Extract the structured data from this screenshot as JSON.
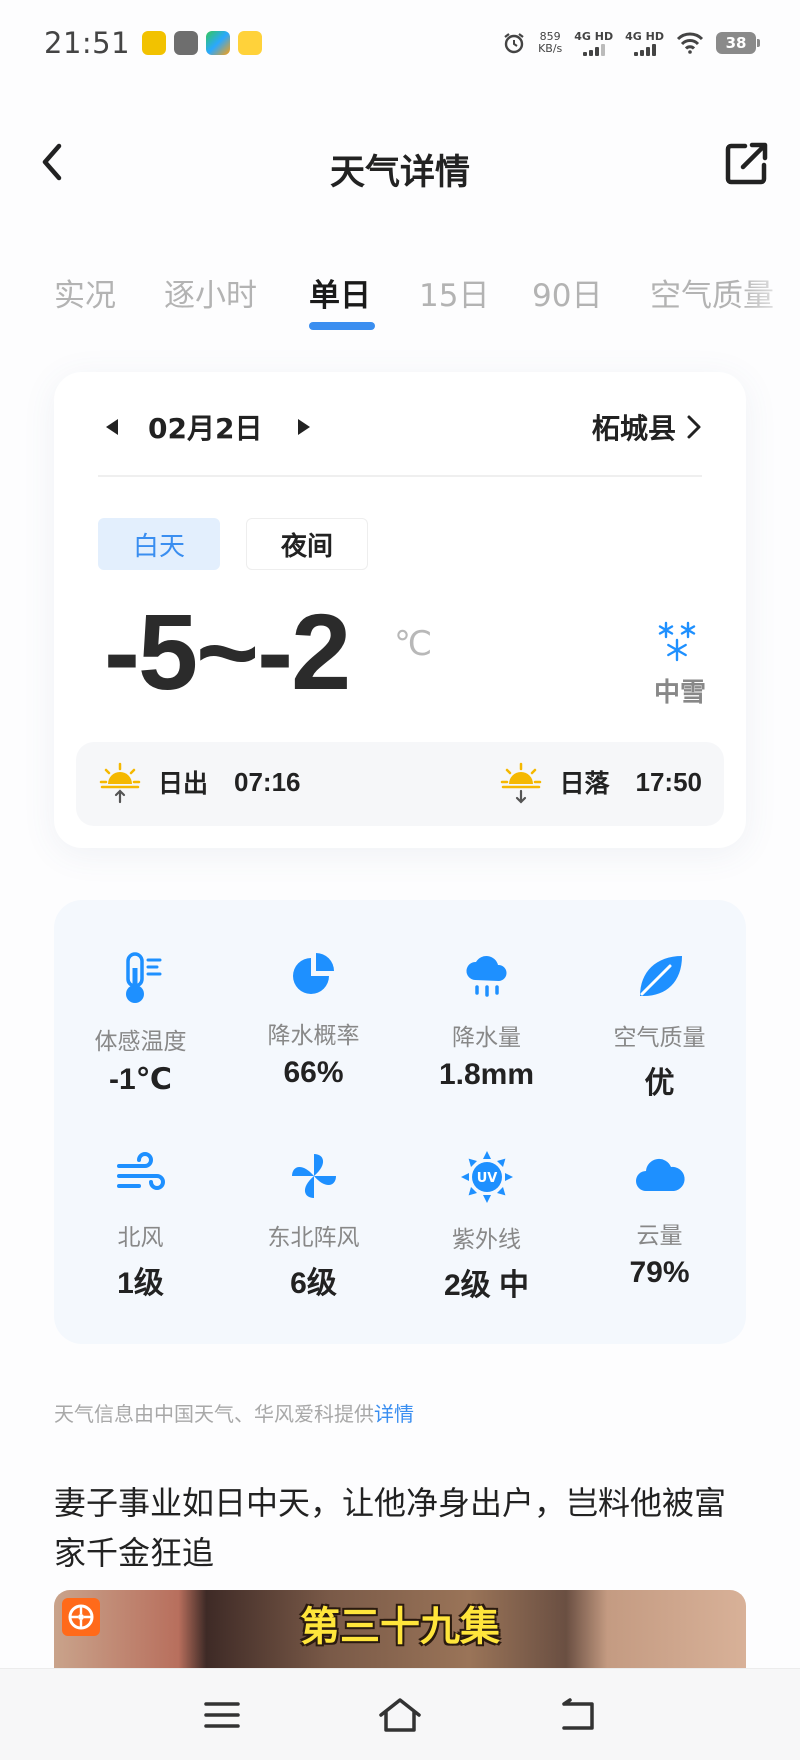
{
  "status_bar": {
    "time": "21:51",
    "net_speed_value": "859",
    "net_speed_unit": "KB/s",
    "sim1": "4G HD",
    "sim2": "4G HD",
    "battery": "38"
  },
  "header": {
    "title": "天气详情"
  },
  "tabs": [
    {
      "label": "实况",
      "active": false
    },
    {
      "label": "逐小时",
      "active": false
    },
    {
      "label": "单日",
      "active": true
    },
    {
      "label": "15日",
      "active": false
    },
    {
      "label": "90日",
      "active": false
    },
    {
      "label": "空气质量",
      "active": false
    }
  ],
  "day_card": {
    "date": "02月2日",
    "location": "柘城县",
    "segments": {
      "day": "白天",
      "night": "夜间",
      "selected": "day"
    },
    "temp_range": "-5~-2",
    "temp_unit": "℃",
    "weather": "中雪",
    "sunrise_label": "日出",
    "sunrise_time": "07:16",
    "sunset_label": "日落",
    "sunset_time": "17:50"
  },
  "metrics": [
    {
      "label": "体感温度",
      "value": "-1℃",
      "icon": "thermometer-icon"
    },
    {
      "label": "降水概率",
      "value": "66%",
      "icon": "pie-chart-icon"
    },
    {
      "label": "降水量",
      "value": "1.8mm",
      "icon": "rain-cloud-icon"
    },
    {
      "label": "空气质量",
      "value": "优",
      "icon": "leaf-icon"
    },
    {
      "label": "北风",
      "value": "1级",
      "icon": "wind-icon"
    },
    {
      "label": "东北阵风",
      "value": "6级",
      "icon": "pinwheel-icon"
    },
    {
      "label": "紫外线",
      "value": "2级 中",
      "icon": "uv-sun-icon"
    },
    {
      "label": "云量",
      "value": "79%",
      "icon": "cloud-icon"
    }
  ],
  "credit": {
    "text": "天气信息由中国天气、华风爱科提供",
    "link": "详情"
  },
  "news": {
    "title": "妻子事业如日中天，让他净身出户，岂料他被富家千金狂追",
    "image_caption": "第三十九集"
  },
  "colors": {
    "accent": "#3a8ef0",
    "icon_blue": "#1e90ff",
    "card_bg": "#f4f8fd",
    "sun_yellow": "#f5b800"
  }
}
